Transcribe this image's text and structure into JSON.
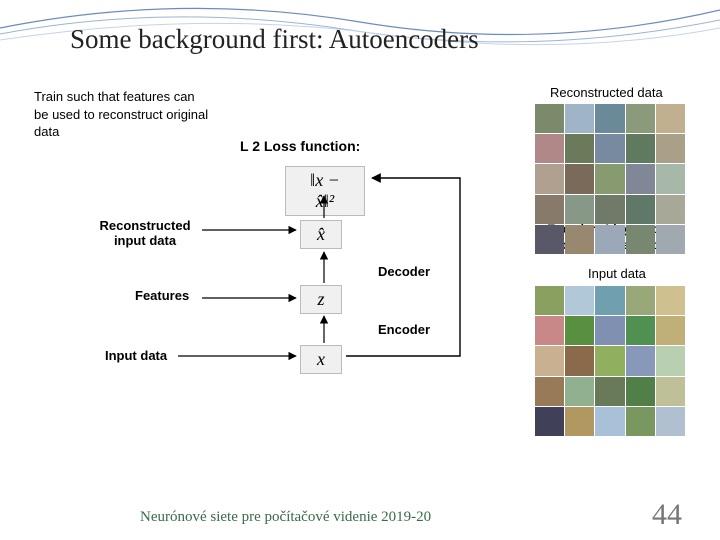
{
  "title": "Some background first: Autoencoders",
  "intro": "Train such that features can be used to reconstruct original data",
  "loss_label": "L 2 Loss function:",
  "math": {
    "loss": "‖x − x̂‖²",
    "xhat": "x̂",
    "z": "z",
    "x": "x"
  },
  "labels": {
    "recon_input": "Reconstructed input data",
    "features": "Features",
    "input_left": "Input data",
    "decoder": "Decoder",
    "encoder": "Encoder",
    "recon_top": "Reconstructed data",
    "enc_line": "Encoder: 4-layer conv",
    "dec_line": "Decoder: 4-layer upconv",
    "input_right": "Input data"
  },
  "footer": {
    "course": "Neurónové siete pre počítačové videnie 2019-20",
    "page": "44"
  },
  "grid_top_colors": [
    "#7a8a6a",
    "#a0b4c8",
    "#6a8a9a",
    "#8a9a7a",
    "#c0b090",
    "#b08888",
    "#6a7a5a",
    "#788aa0",
    "#607a60",
    "#aaa088",
    "#b0a090",
    "#7a6a5a",
    "#889a70",
    "#808898",
    "#a8b8a8",
    "#887a6a",
    "#889888",
    "#707a68",
    "#607868",
    "#a8a898",
    "#585868",
    "#988870",
    "#9aa8b8",
    "#788870",
    "#a0a8b0"
  ],
  "grid_bot_colors": [
    "#8aa060",
    "#b0c8d8",
    "#70a0b0",
    "#98a878",
    "#d0c090",
    "#c88888",
    "#589040",
    "#8090b0",
    "#509050",
    "#c0b078",
    "#c8b090",
    "#8a6a4a",
    "#90b060",
    "#8898b8",
    "#b8d0b0",
    "#987a58",
    "#90b090",
    "#687a58",
    "#508048",
    "#c0c098",
    "#404058",
    "#b09860",
    "#a8c0d8",
    "#789860",
    "#b0c0d0"
  ]
}
